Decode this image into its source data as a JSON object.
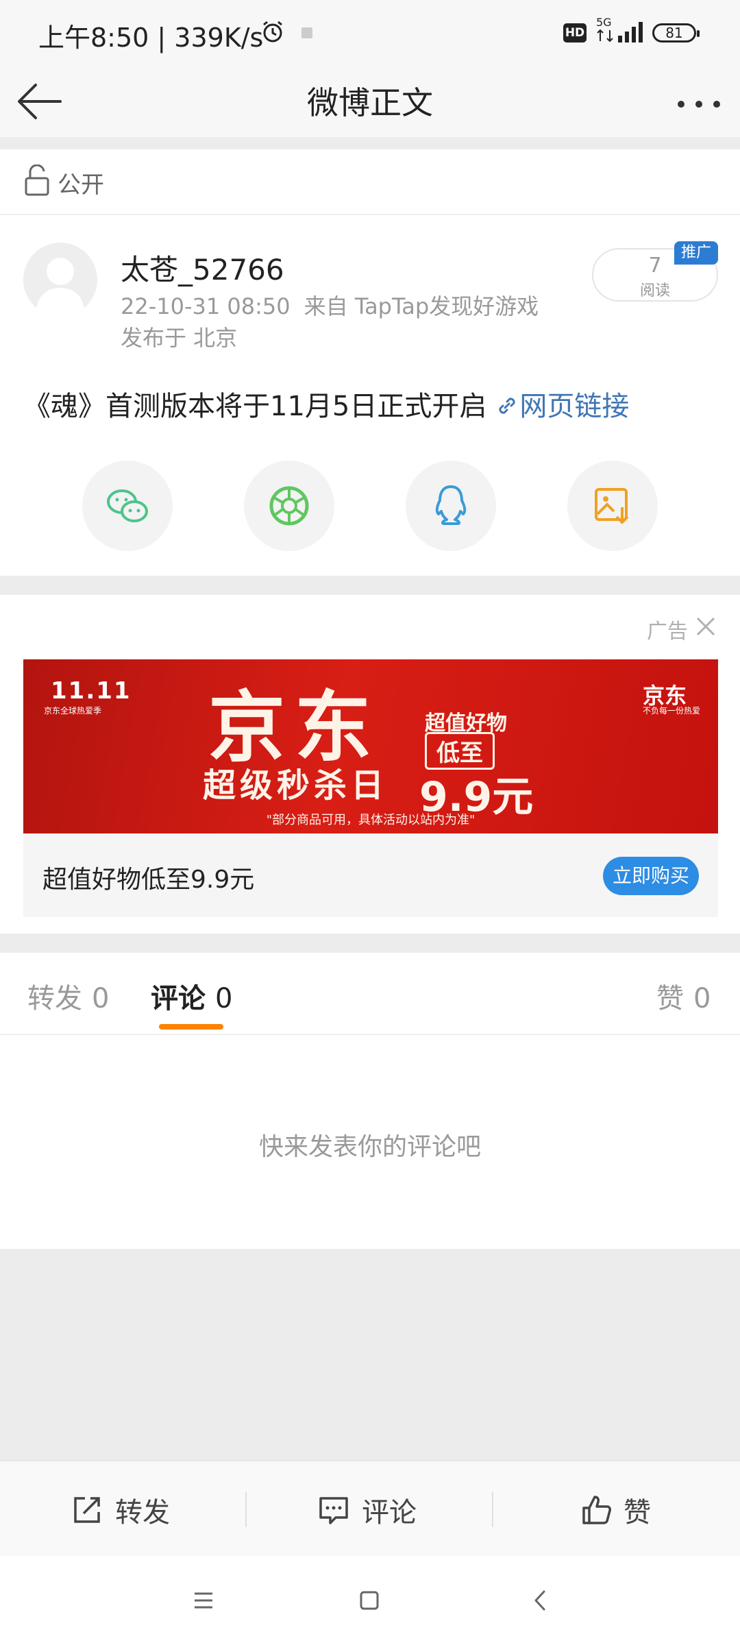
{
  "status_bar": {
    "time": "上午8:50 | 339K/s",
    "hd_badge": "HD",
    "network": "5G",
    "battery": "81"
  },
  "nav": {
    "title": "微博正文"
  },
  "visibility": {
    "label": "公开"
  },
  "post": {
    "author": "太苍_52766",
    "time": "22-10-31 08:50",
    "source": "来自 TapTap发现好游戏",
    "location": "发布于 北京",
    "reads": "7",
    "reads_label": "阅读",
    "promo_tag": "推广",
    "text": "《魂》首测版本将于11月5日正式开启",
    "link_text": "网页链接",
    "share_icons": [
      "wechat-icon",
      "moments-icon",
      "qq-icon",
      "save-image-icon"
    ]
  },
  "ad": {
    "label": "广告",
    "banner": {
      "logo": "11.11",
      "logo_sub": "京东全球热爱季",
      "headline": "京东",
      "subline": "超级秒杀日",
      "good": "超值好物",
      "low": "低至",
      "price": "9.9元",
      "brand": "京东",
      "brand_sub": "不负每一份热爱",
      "disclaimer": "\"部分商品可用，具体活动以站内为准\""
    },
    "title": "超值好物低至9.9元",
    "cta": "立即购买"
  },
  "tabs": [
    {
      "label": "转发",
      "count": "0"
    },
    {
      "label": "评论",
      "count": "0"
    },
    {
      "label": "赞",
      "count": "0"
    }
  ],
  "empty_message": "快来发表你的评论吧",
  "actions": [
    {
      "label": "转发",
      "icon": "repost-icon"
    },
    {
      "label": "评论",
      "icon": "comment-icon"
    },
    {
      "label": "赞",
      "icon": "thumbs-up-icon"
    }
  ],
  "colors": {
    "accent_orange": "#ff8200",
    "link_blue": "#3f76b4",
    "cta_blue": "#2d8ce3",
    "banner_red": "#d81e15"
  }
}
